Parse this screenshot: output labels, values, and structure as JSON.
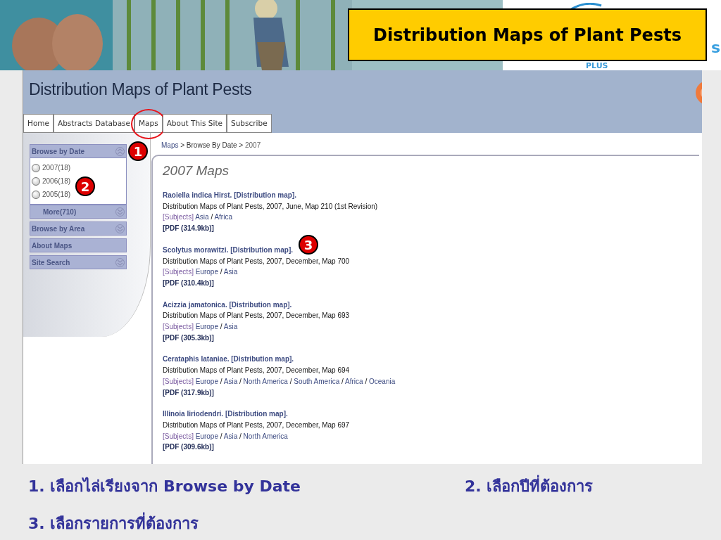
{
  "slide_title": "Distribution Maps of Plant Pests",
  "logo_texts": [
    "s",
    "PLUS"
  ],
  "site": {
    "title": "Distribution Maps of Plant Pests",
    "tabs": [
      {
        "label": "Home",
        "circled": false
      },
      {
        "label": "Abstracts Database",
        "circled": false
      },
      {
        "label": "Maps",
        "circled": true
      },
      {
        "label": "About This Site",
        "circled": false
      },
      {
        "label": "Subscribe",
        "circled": false
      }
    ],
    "sidebar": [
      {
        "label": "Browse by Date",
        "expanded": true,
        "options": [
          {
            "label": "2007(18)",
            "selected": false
          },
          {
            "label": "2006(18)",
            "selected": false
          },
          {
            "label": "2005(18)",
            "selected": false
          }
        ],
        "more": "More(710)"
      },
      {
        "label": "Browse by Area",
        "expanded": false
      },
      {
        "label": "About Maps"
      },
      {
        "label": "Site Search",
        "expanded": false
      }
    ],
    "breadcrumb": {
      "items": [
        "Maps",
        "Browse By Date",
        "2007"
      ],
      "separator": ">"
    },
    "heading": "2007 Maps",
    "subject_separator": "/",
    "results": [
      {
        "title": "Raoiella indica Hirst. [Distribution map].",
        "citation": "Distribution Maps of Plant Pests, 2007, June, Map 210 (1st Revision)",
        "subjects_label": "[Subjects]",
        "subjects": [
          "Asia",
          "Africa"
        ],
        "pdf": "[PDF (314.9kb)]"
      },
      {
        "title": "Scolytus morawitzi. [Distribution map].",
        "citation": "Distribution Maps of Plant Pests, 2007, December, Map 700",
        "subjects_label": "[Subjects]",
        "subjects": [
          "Europe",
          "Asia"
        ],
        "pdf": "[PDF (310.4kb)]"
      },
      {
        "title": "Acizzia jamatonica. [Distribution map].",
        "citation": "Distribution Maps of Plant Pests, 2007, December, Map 693",
        "subjects_label": "[Subjects]",
        "subjects": [
          "Europe",
          "Asia"
        ],
        "pdf": "[PDF (305.3kb)]"
      },
      {
        "title": "Cerataphis lataniae. [Distribution map].",
        "citation": "Distribution Maps of Plant Pests, 2007, December, Map 694",
        "subjects_label": "[Subjects]",
        "subjects": [
          "Europe",
          "Asia",
          "North America",
          "South America",
          "Africa",
          "Oceania"
        ],
        "pdf": "[PDF (317.9kb)]"
      },
      {
        "title": "Illinoia liriodendri. [Distribution map].",
        "citation": "Distribution Maps of Plant Pests, 2007, December, Map 697",
        "subjects_label": "[Subjects]",
        "subjects": [
          "Europe",
          "Asia",
          "North America"
        ],
        "pdf": "[PDF (309.6kb)]"
      }
    ]
  },
  "callouts": [
    "1",
    "2",
    "3"
  ],
  "instructions": [
    "1. เลือกไล่เรียงจาก Browse by Date",
    "2. เลือกปีที่ต้องการ",
    "3. เลือกรายการที่ต้องการ"
  ]
}
